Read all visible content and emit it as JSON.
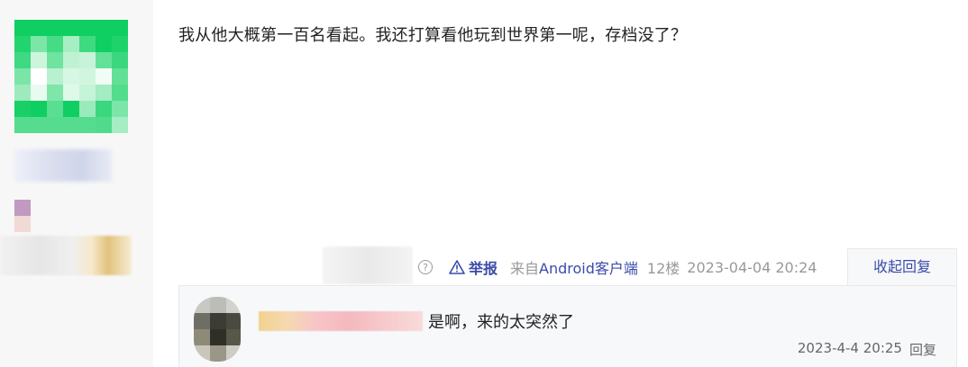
{
  "post": {
    "text": "我从他大概第一百名看起。我还打算看他玩到世界第一呢，存档没了？"
  },
  "meta": {
    "help_glyph": "?",
    "report_label": "举报",
    "source_prefix": "来自",
    "source_link": "Android客户端",
    "floor": "12楼",
    "timestamp": "2023-04-04 20:24"
  },
  "reply_toggle_label": "收起回复",
  "reply": {
    "text": "是啊，来的太突然了",
    "timestamp": "2023-4-4 20:25",
    "reply_label": "回复"
  },
  "colors": {
    "accent": "#3b4ba8",
    "muted": "#999999",
    "panel_bg": "#f7f8fa"
  }
}
